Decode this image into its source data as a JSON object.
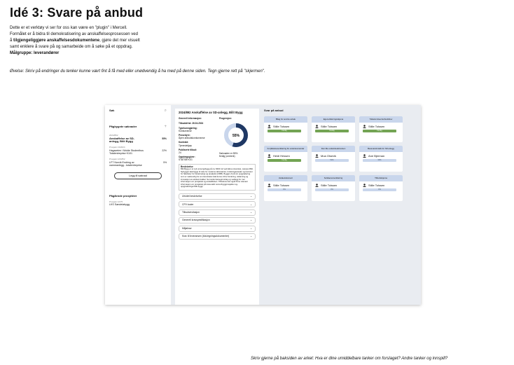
{
  "page": {
    "title": "Idé 3: Svare på anbud",
    "intro_line1": "Dette er et verktøy vi ser for oss kan være en \"plugin\" i Mercell.",
    "intro_line2": "Formålet er å bidra til demokratisering av anskaffelsesprosessen ved",
    "intro_line3_pre": "å ",
    "intro_line3_bold": "tilgjengeliggjøre anskaffelsesdokumentene",
    "intro_line3_post": ", gjøre det mer visuelt",
    "intro_line4": "samt enklere å svare på og samarbeide om å søke på et oppdrag.",
    "target_group": "Målgruppe: leverandører",
    "exercise": "Øvelse: Skriv på endringer du tenker kunne vært fint å få med eller unødvendig å ha med på denne siden. Tegn gjerne rett på \"skjermen\".",
    "footer": "Skriv gjerne på baksiden av arket: Hva er dine umiddelbare tanker om forslaget? Andre tanker og innspill?"
  },
  "sidebar": {
    "search_label": "Søk",
    "search_icon": "⌕",
    "recent_title": "Pågbygnte søknader",
    "add_icon": "+",
    "items": [
      {
        "line1": "2024/892",
        "line2": "Anskaffelse av SD-",
        "line3": "anlegg, Bilit Bygg",
        "pct": "55%"
      },
      {
        "line1": "Prosjekt 13/2024",
        "line2": "Hagaveien i Molde Studenthus",
        "line3": "Totalentreprise K101",
        "pct": "22%"
      },
      {
        "line1": "Prosjekt 12/1852",
        "line2": "LFT Norvik Endring av",
        "line3": "varmeanlegg - totalentreprise",
        "pct": "5%"
      }
    ],
    "add_button": "Legg til søknad",
    "ongoing_title": "Pågående prosjekter",
    "ongoing_line1": "Prosjekt 12/75",
    "ongoing_line2": "LKS Søndelabygg"
  },
  "detail": {
    "title": "2024/892 Anskaffelse av SD-anlegg, Bilit Bygg",
    "general_label": "Generell informasjon:",
    "progress_label": "Progresjon:",
    "fields": [
      {
        "label": "Tilbudsfrist: 26.04.2024",
        "value": ""
      },
      {
        "label": "Typekunngjøring:",
        "value": "Konkurranse"
      },
      {
        "label": "Prosedyre:",
        "value": "Åpen anbudskonkurranse"
      },
      {
        "label": "Kontrakt:",
        "value": "Tjenestekjøp"
      },
      {
        "label": "Publiserte tilbud:",
        "value": "24"
      },
      {
        "label": "Oppdragsgiver:",
        "value": "STATSBYGG"
      }
    ],
    "progress_value": 55,
    "progress_text": "55%",
    "progress_note1": "Søknaden er 55%",
    "progress_note2": "ferdig (omtrent)",
    "desc_title": "Beskrivelse",
    "desc_body": "Bilit Bygg er et nytt omsorgsbygg på ca. 8400 m2 ved Ekra universitet, campus Bilit. Nybygget skal legge til rette for moderne laboratorier, forskningsarealer og kontorer for fakulteter for bioteknologi og arealplan (FMB). Bygget vil på sin oppgradering som er nødvendig for at universitetet skal kunne drive forskning, utdanning og innovasjon av ønsket kvalitet. Se konkurransegrunnlag og vedlegg for mer informasjon om prosjektet og anskaffelsen. Tilbudene kan også finne relevant informasjon om prosjektet på www.sskb.no/om/byggprosjekter-og-oppgraderinger/bilit-bygg/",
    "accordions": [
      "Utvidet beskrivelse",
      "CPV koder",
      "Tilbudsinvitasjon",
      "Generell kravspesifikasjon",
      "Miljøkrav",
      "Krav til leveransen (bla.tegningsdokumenter)"
    ],
    "chevron": "⌄"
  },
  "bid": {
    "title": "Svar på anbud",
    "cards": [
      {
        "title": "Bilag for service avtale",
        "person": "Stille Tolssen",
        "status": "Ferdig",
        "done": true
      },
      {
        "title": "Egenerklæringsskjema",
        "person": "Stille Tolssen",
        "status": "Ferdig",
        "done": true
      },
      {
        "title": "Tolkekomiteer/anbudsbrev",
        "person": "Stille Tolssen",
        "status": "Ferdig",
        "done": true
      },
      {
        "title": "Forpliktelseserklæring fra underleverandør",
        "person": "Heidi Hessen",
        "status": "Ferdig",
        "done": true
      },
      {
        "title": "Den lille endelsbeskrivelsen",
        "person": "Moa Olsevik",
        "status": "50%",
        "done": false
      },
      {
        "title": "Bessvarsfordelk for SD anlegg",
        "person": "Ane Bjerman",
        "status": "30%",
        "done": false
      },
      {
        "title": "Avtaledokument",
        "person": "Stille Tolssen",
        "status": "0%",
        "done": false
      },
      {
        "title": "Solidaerenserklæring",
        "person": "Stille Tolssen",
        "status": "0%",
        "done": false
      },
      {
        "title": "Tilbudsskjema",
        "person": "Stille Tolssen",
        "status": "0%",
        "done": false
      }
    ]
  },
  "colors": {
    "done_bar": "#73a454",
    "pending_bar": "#c9d6ec",
    "donut_fill": "#1f3864",
    "donut_track": "#c9d6ec"
  }
}
